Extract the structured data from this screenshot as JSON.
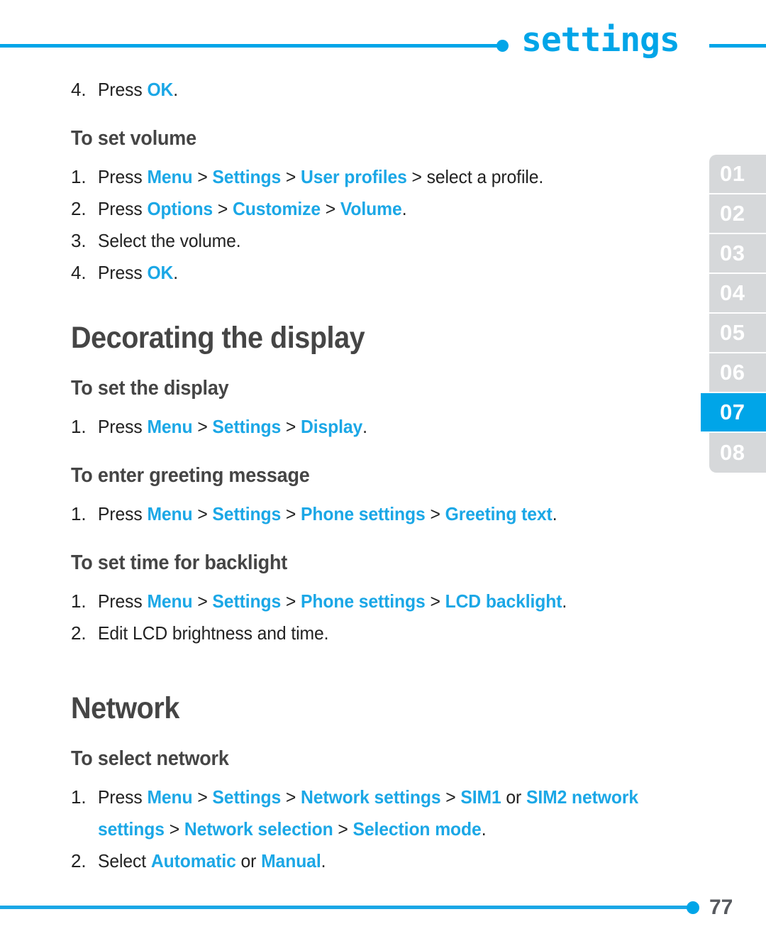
{
  "header": {
    "title": "settings",
    "dot_icon": "bullet-dot-icon",
    "accent_color": "#00a5e8"
  },
  "chapter_tabs": {
    "items": [
      {
        "label": "01",
        "active": false
      },
      {
        "label": "02",
        "active": false
      },
      {
        "label": "03",
        "active": false
      },
      {
        "label": "04",
        "active": false
      },
      {
        "label": "05",
        "active": false
      },
      {
        "label": "06",
        "active": false
      },
      {
        "label": "07",
        "active": true
      },
      {
        "label": "08",
        "active": false
      }
    ],
    "active_color": "#00a5e8",
    "inactive_color": "#d6d8da"
  },
  "content": {
    "orphan_step": {
      "num": "4.",
      "press": "Press ",
      "key": "OK",
      "period": "."
    },
    "set_volume": {
      "heading": "To set volume",
      "steps": [
        {
          "num": "1.",
          "press": "Press ",
          "t1": "Menu",
          "s1": " > ",
          "t2": "Settings",
          "s2": " > ",
          "t3": "User profiles",
          "s3": " > ",
          "tail": "select a profile."
        },
        {
          "num": "2.",
          "press": "Press ",
          "t1": "Options",
          "s1": " > ",
          "t2": "Customize",
          "s2": " > ",
          "t3": "Volume",
          "tail": "."
        },
        {
          "num": "3.",
          "text": "Select the volume."
        },
        {
          "num": "4.",
          "press": "Press ",
          "t1": "OK",
          "tail": "."
        }
      ]
    },
    "decorating_display": {
      "heading": "Decorating the display",
      "set_display": {
        "heading": "To set the display",
        "step": {
          "num": "1.",
          "press": "Press ",
          "t1": "Menu",
          "s1": " > ",
          "t2": "Settings",
          "s2": " > ",
          "t3": "Display",
          "tail": "."
        }
      },
      "greeting_message": {
        "heading": "To enter greeting message",
        "step": {
          "num": "1.",
          "press": "Press ",
          "t1": "Menu",
          "s1": " > ",
          "t2": "Settings",
          "s2": " > ",
          "t3": "Phone settings",
          "s3": " > ",
          "t4": "Greeting text",
          "tail": "."
        }
      },
      "backlight": {
        "heading": "To set time for backlight",
        "steps": [
          {
            "num": "1.",
            "press": "Press ",
            "t1": "Menu",
            "s1": " > ",
            "t2": "Settings",
            "s2": " > ",
            "t3": "Phone settings",
            "s3": " > ",
            "t4": "LCD backlight",
            "tail": "."
          },
          {
            "num": "2.",
            "text": "Edit LCD brightness and time."
          }
        ]
      }
    },
    "network": {
      "heading": "Network",
      "select_network": {
        "heading": "To select network",
        "steps": [
          {
            "num": "1.",
            "press": "Press ",
            "t1": "Menu",
            "s1": " > ",
            "t2": "Settings",
            "s2": " > ",
            "t3": "Network settings",
            "s3": " > ",
            "t4": "SIM1",
            "or1": " or ",
            "t5": "SIM2",
            "line2_t1": "network settings",
            "line2_s1": " > ",
            "line2_t2": "Network selection",
            "line2_s2": " > ",
            "line2_t3": "Selection mode",
            "tail": "."
          },
          {
            "num": "2.",
            "select": "Select ",
            "t1": "Automatic",
            "or1": " or ",
            "t2": "Manual",
            "tail": "."
          }
        ]
      }
    }
  },
  "footer": {
    "page_number": "77",
    "dot_icon": "bullet-dot-icon"
  }
}
